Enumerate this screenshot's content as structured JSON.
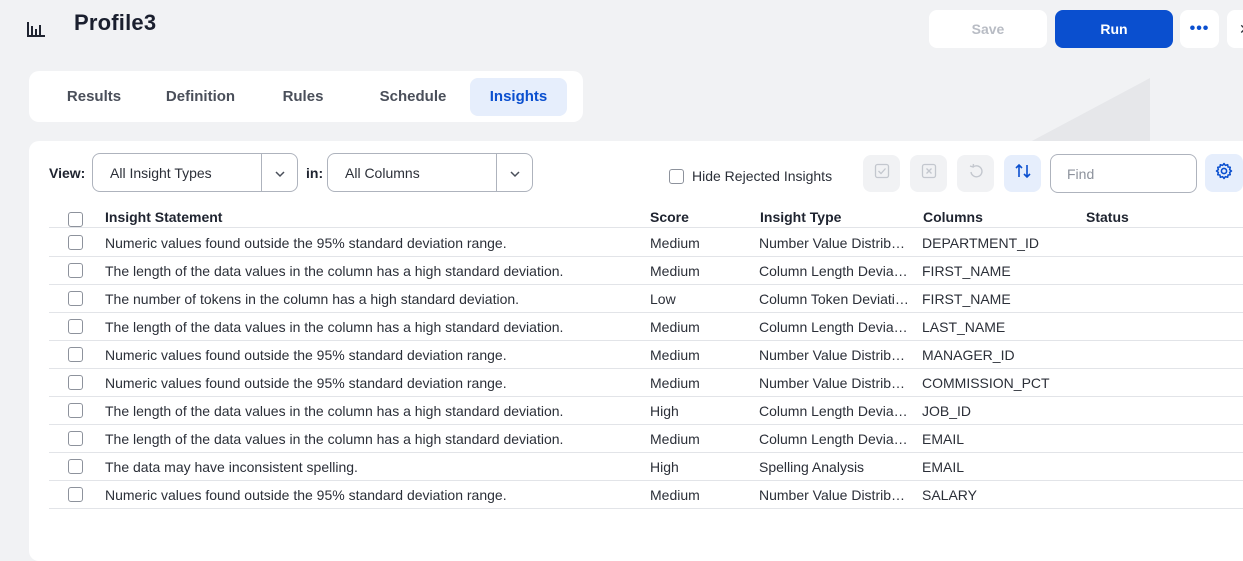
{
  "header": {
    "title": "Profile3",
    "save_label": "Save",
    "run_label": "Run",
    "more_label": "•••"
  },
  "tabs": [
    {
      "label": "Results"
    },
    {
      "label": "Definition"
    },
    {
      "label": "Rules"
    },
    {
      "label": "Schedule"
    },
    {
      "label": "Insights",
      "active": true
    }
  ],
  "filters": {
    "view_label": "View:",
    "view_value": "All Insight Types",
    "in_label": "in:",
    "in_value": "All Columns",
    "hide_rejected_label": "Hide Rejected Insights",
    "find_placeholder": "Find"
  },
  "table": {
    "columns": [
      "Insight Statement",
      "Score",
      "Insight Type",
      "Columns",
      "Status"
    ],
    "rows": [
      {
        "statement": "Numeric values found outside the 95% standard deviation range.",
        "score": "Medium",
        "type": "Number Value Distrib…",
        "column": "DEPARTMENT_ID",
        "status": ""
      },
      {
        "statement": "The length of the data values in the column has a high standard deviation.",
        "score": "Medium",
        "type": "Column Length Devia…",
        "column": "FIRST_NAME",
        "status": ""
      },
      {
        "statement": "The number of tokens in the column has a high standard deviation.",
        "score": "Low",
        "type": "Column Token Deviati…",
        "column": "FIRST_NAME",
        "status": ""
      },
      {
        "statement": "The length of the data values in the column has a high standard deviation.",
        "score": "Medium",
        "type": "Column Length Devia…",
        "column": "LAST_NAME",
        "status": ""
      },
      {
        "statement": "Numeric values found outside the 95% standard deviation range.",
        "score": "Medium",
        "type": "Number Value Distrib…",
        "column": "MANAGER_ID",
        "status": ""
      },
      {
        "statement": "Numeric values found outside the 95% standard deviation range.",
        "score": "Medium",
        "type": "Number Value Distrib…",
        "column": "COMMISSION_PCT",
        "status": ""
      },
      {
        "statement": "The length of the data values in the column has a high standard deviation.",
        "score": "High",
        "type": "Column Length Devia…",
        "column": "JOB_ID",
        "status": ""
      },
      {
        "statement": "The length of the data values in the column has a high standard deviation.",
        "score": "Medium",
        "type": "Column Length Devia…",
        "column": "EMAIL",
        "status": ""
      },
      {
        "statement": "The data may have inconsistent spelling.",
        "score": "High",
        "type": "Spelling Analysis",
        "column": "EMAIL",
        "status": ""
      },
      {
        "statement": "Numeric values found outside the 95% standard deviation range.",
        "score": "Medium",
        "type": "Number Value Distrib…",
        "column": "SALARY",
        "status": ""
      }
    ]
  },
  "colors": {
    "accent": "#0a4fcf",
    "accent_light": "#e6eefc",
    "background": "#f1f2f4"
  },
  "icons": [
    "bar-chart-icon",
    "chevron-down-icon",
    "checkbox-icon",
    "accept-icon",
    "reject-icon",
    "undo-icon",
    "sort-icon",
    "gear-icon",
    "close-icon"
  ]
}
